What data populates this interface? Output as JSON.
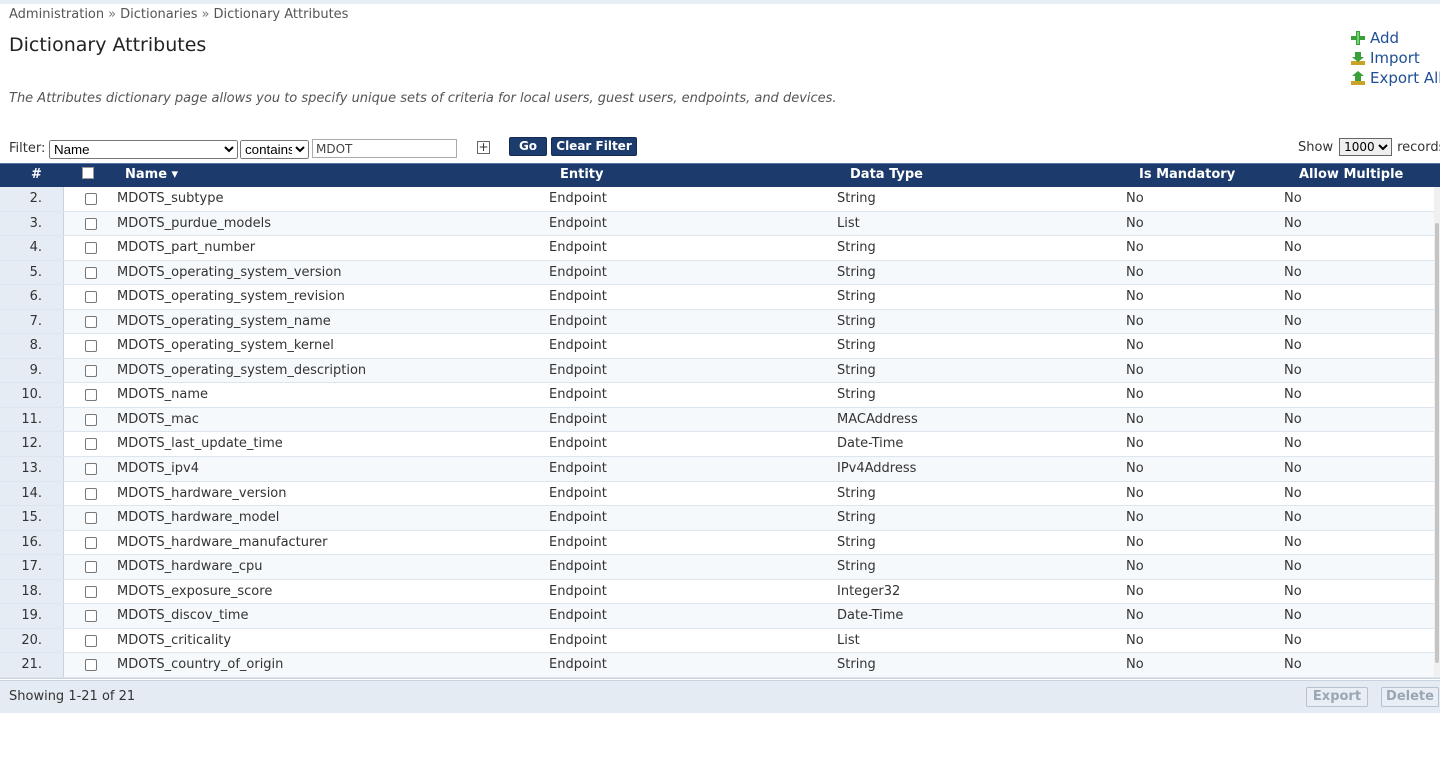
{
  "breadcrumb": [
    "Administration",
    "Dictionaries",
    "Dictionary Attributes"
  ],
  "breadcrumb_sep": "»",
  "title": "Dictionary Attributes",
  "actions": {
    "add": "Add",
    "import": "Import",
    "export_all": "Export All"
  },
  "description": "The Attributes dictionary page allows you to specify unique sets of criteria for local users, guest users, endpoints, and devices.",
  "filter": {
    "label": "Filter:",
    "field": "Name",
    "operator": "contains",
    "value": "MDOT",
    "add_symbol": "+",
    "go": "Go",
    "clear": "Clear Filter"
  },
  "show": {
    "label": "Show",
    "value": "1000",
    "suffix": "records"
  },
  "columns": {
    "num": "#",
    "name": "Name ▾",
    "entity": "Entity",
    "data_type": "Data Type",
    "mandatory": "Is Mandatory",
    "multiple": "Allow Multiple"
  },
  "rows": [
    {
      "num": "2.",
      "name": "MDOTS_subtype",
      "entity": "Endpoint",
      "type": "String",
      "mandatory": "No",
      "multiple": "No"
    },
    {
      "num": "3.",
      "name": "MDOTS_purdue_models",
      "entity": "Endpoint",
      "type": "List",
      "mandatory": "No",
      "multiple": "No"
    },
    {
      "num": "4.",
      "name": "MDOTS_part_number",
      "entity": "Endpoint",
      "type": "String",
      "mandatory": "No",
      "multiple": "No"
    },
    {
      "num": "5.",
      "name": "MDOTS_operating_system_version",
      "entity": "Endpoint",
      "type": "String",
      "mandatory": "No",
      "multiple": "No"
    },
    {
      "num": "6.",
      "name": "MDOTS_operating_system_revision",
      "entity": "Endpoint",
      "type": "String",
      "mandatory": "No",
      "multiple": "No"
    },
    {
      "num": "7.",
      "name": "MDOTS_operating_system_name",
      "entity": "Endpoint",
      "type": "String",
      "mandatory": "No",
      "multiple": "No"
    },
    {
      "num": "8.",
      "name": "MDOTS_operating_system_kernel",
      "entity": "Endpoint",
      "type": "String",
      "mandatory": "No",
      "multiple": "No"
    },
    {
      "num": "9.",
      "name": "MDOTS_operating_system_description",
      "entity": "Endpoint",
      "type": "String",
      "mandatory": "No",
      "multiple": "No"
    },
    {
      "num": "10.",
      "name": "MDOTS_name",
      "entity": "Endpoint",
      "type": "String",
      "mandatory": "No",
      "multiple": "No"
    },
    {
      "num": "11.",
      "name": "MDOTS_mac",
      "entity": "Endpoint",
      "type": "MACAddress",
      "mandatory": "No",
      "multiple": "No"
    },
    {
      "num": "12.",
      "name": "MDOTS_last_update_time",
      "entity": "Endpoint",
      "type": "Date-Time",
      "mandatory": "No",
      "multiple": "No"
    },
    {
      "num": "13.",
      "name": "MDOTS_ipv4",
      "entity": "Endpoint",
      "type": "IPv4Address",
      "mandatory": "No",
      "multiple": "No"
    },
    {
      "num": "14.",
      "name": "MDOTS_hardware_version",
      "entity": "Endpoint",
      "type": "String",
      "mandatory": "No",
      "multiple": "No"
    },
    {
      "num": "15.",
      "name": "MDOTS_hardware_model",
      "entity": "Endpoint",
      "type": "String",
      "mandatory": "No",
      "multiple": "No"
    },
    {
      "num": "16.",
      "name": "MDOTS_hardware_manufacturer",
      "entity": "Endpoint",
      "type": "String",
      "mandatory": "No",
      "multiple": "No"
    },
    {
      "num": "17.",
      "name": "MDOTS_hardware_cpu",
      "entity": "Endpoint",
      "type": "String",
      "mandatory": "No",
      "multiple": "No"
    },
    {
      "num": "18.",
      "name": "MDOTS_exposure_score",
      "entity": "Endpoint",
      "type": "Integer32",
      "mandatory": "No",
      "multiple": "No"
    },
    {
      "num": "19.",
      "name": "MDOTS_discov_time",
      "entity": "Endpoint",
      "type": "Date-Time",
      "mandatory": "No",
      "multiple": "No"
    },
    {
      "num": "20.",
      "name": "MDOTS_criticality",
      "entity": "Endpoint",
      "type": "List",
      "mandatory": "No",
      "multiple": "No"
    },
    {
      "num": "21.",
      "name": "MDOTS_country_of_origin",
      "entity": "Endpoint",
      "type": "String",
      "mandatory": "No",
      "multiple": "No"
    }
  ],
  "footer": {
    "showing": "Showing 1-21 of 21",
    "export": "Export",
    "delete": "Delete"
  },
  "icons": {
    "add": "plus-icon",
    "import": "import-icon",
    "export_all": "export-icon"
  },
  "colors": {
    "header_bg": "#1c3a6b",
    "link": "#1f4f94",
    "button_dark": "#1d3c6e",
    "footer_bg": "#e4ebf3"
  }
}
